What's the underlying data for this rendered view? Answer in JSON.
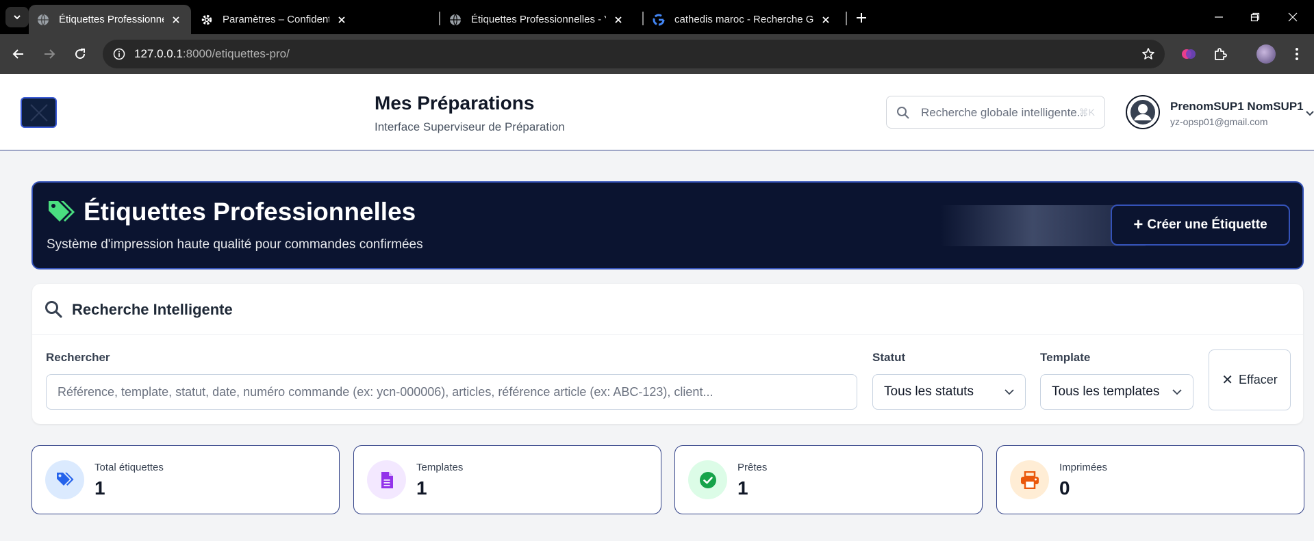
{
  "browser": {
    "tabs": [
      {
        "title": "Étiquettes Professionnelles - YZ",
        "favicon": "globe-icon",
        "active": true
      },
      {
        "title": "Paramètres – Confidentialité et",
        "favicon": "gear-icon",
        "active": false
      },
      {
        "title": "Étiquettes Professionnelles - YZ",
        "favicon": "globe-icon",
        "active": false
      },
      {
        "title": "cathedis maroc - Recherche Goo",
        "favicon": "google-icon",
        "active": false
      }
    ],
    "url_host": "127.0.0.1",
    "url_path": ":8000/etiquettes-pro/"
  },
  "header": {
    "title": "Mes Préparations",
    "subtitle": "Interface Superviseur de Préparation",
    "search_placeholder": "Recherche globale intelligente...",
    "search_shortcut": "⌘K",
    "user_name": "PrenomSUP1 NomSUP1",
    "user_email": "yz-opsp01@gmail.com"
  },
  "hero": {
    "title": "Étiquettes Professionnelles",
    "subtitle": "Système d'impression haute qualité pour commandes confirmées",
    "create_button": "Créer une Étiquette"
  },
  "search_panel": {
    "title": "Recherche Intelligente",
    "search_label": "Rechercher",
    "search_placeholder": "Référence, template, statut, date, numéro commande (ex: ycn-000006), articles, référence article (ex: ABC-123), client...",
    "status_label": "Statut",
    "status_value": "Tous les statuts",
    "template_label": "Template",
    "template_value": "Tous les templates",
    "clear_button": "Effacer"
  },
  "stats": [
    {
      "label": "Total étiquettes",
      "value": "1",
      "icon": "tags-icon",
      "color": "#2563eb",
      "bg": "#dbeafe"
    },
    {
      "label": "Templates",
      "value": "1",
      "icon": "file-icon",
      "color": "#9333ea",
      "bg": "#f3e8ff"
    },
    {
      "label": "Prêtes",
      "value": "1",
      "icon": "check-circle-icon",
      "color": "#16a34a",
      "bg": "#dcfce7"
    },
    {
      "label": "Imprimées",
      "value": "0",
      "icon": "printer-icon",
      "color": "#ea580c",
      "bg": "#ffedd5"
    }
  ],
  "colors": {
    "hero_bg": "#0b1430",
    "accent_border": "#3452b8",
    "tag_green": "#4ade80"
  }
}
